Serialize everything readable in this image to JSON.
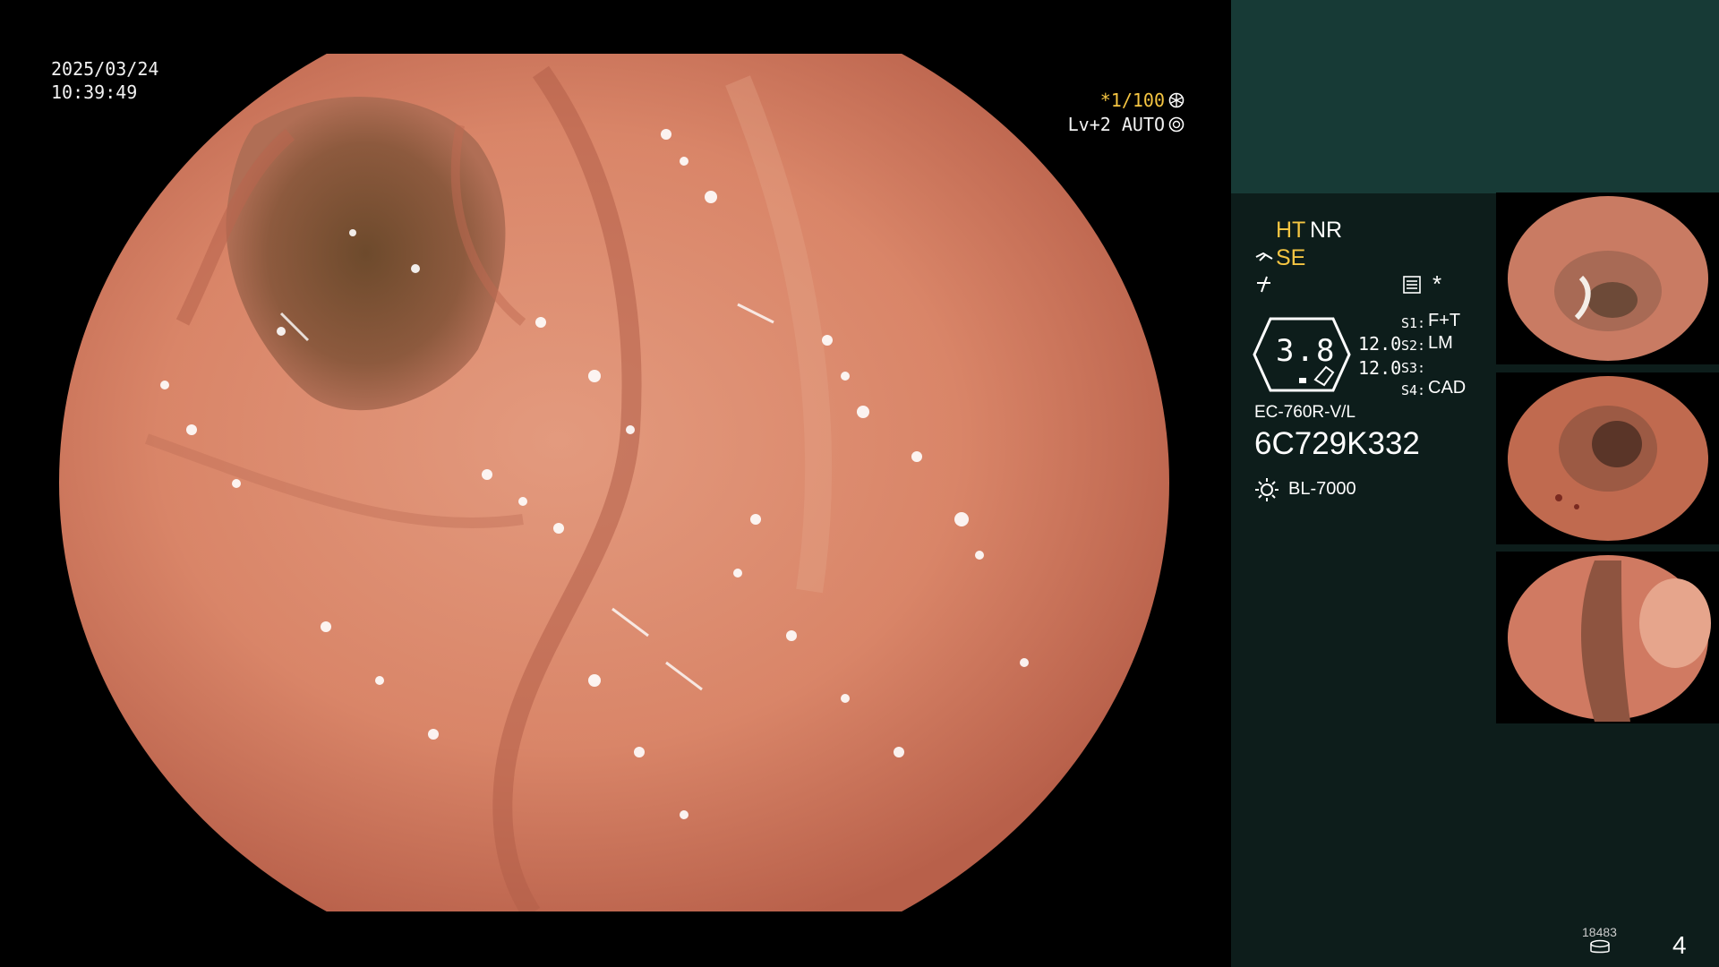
{
  "overlay": {
    "date": "2025/03/24",
    "time": "10:39:49",
    "exposure": "*1/100",
    "exposure_icon": "shutter-icon",
    "level": "Lv+2 AUTO",
    "level_icon": "iris-icon"
  },
  "panel": {
    "ht": "HT",
    "nr": "NR",
    "se": "SE",
    "star": "*",
    "zoom_value": "3.8",
    "value_a": "12.0",
    "value_b": "12.0",
    "s1_label": "S1:",
    "s1_value": "F+T",
    "s2_label": "S2:",
    "s2_value": "LM",
    "s3_label": "S3:",
    "s4_label": "S4:",
    "s4_value": "CAD",
    "scope_model": "EC-760R-V/L",
    "scope_serial": "6C729K332",
    "light_source": "BL-7000",
    "count": "18483",
    "page": "4"
  },
  "colors": {
    "accent_yellow": "#f5c542",
    "panel_header": "#173a36",
    "panel_body": "#0d1d1b",
    "tissue": "#d88a6f"
  }
}
